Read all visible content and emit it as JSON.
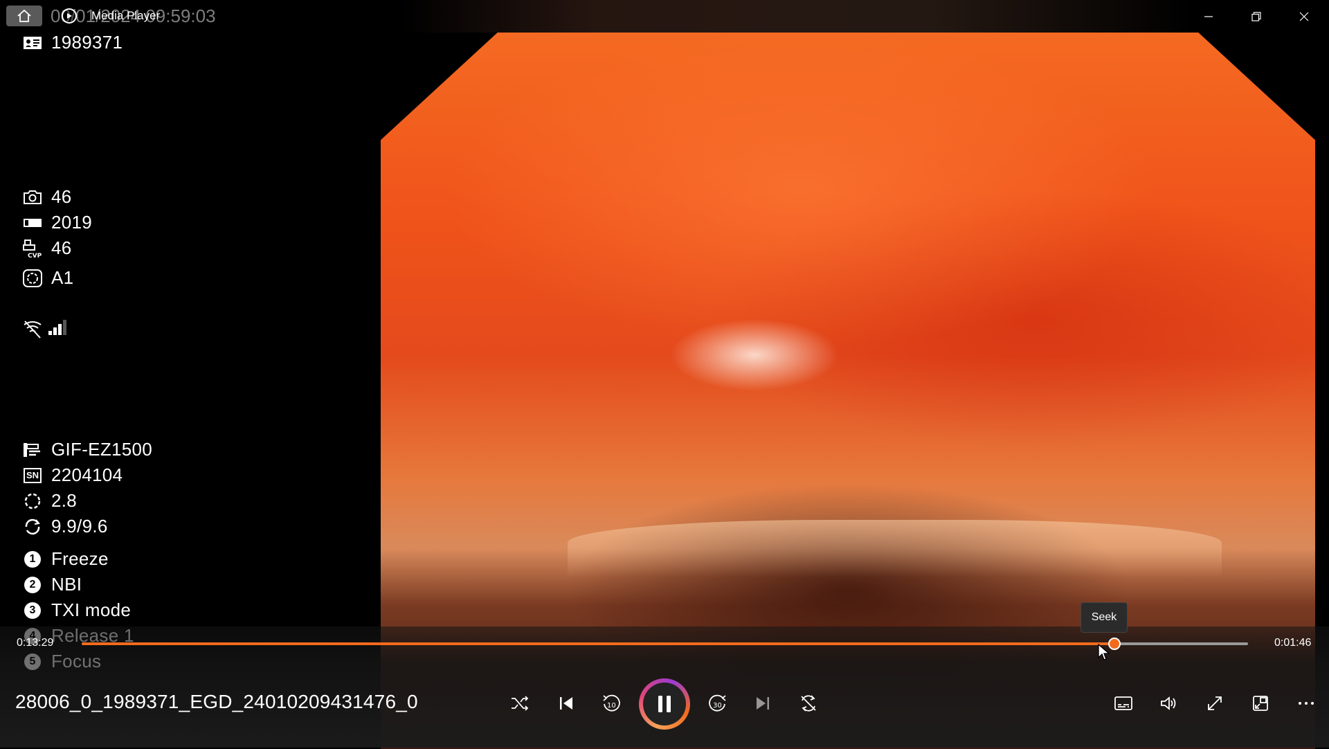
{
  "window": {
    "app_title": "Media Player",
    "overlay_datetime": "00/01/2024 09:59:03"
  },
  "overlay": {
    "patient_id": "1989371",
    "items_top": [
      {
        "icon": "camera-icon",
        "text": "46"
      },
      {
        "icon": "memory-bar-icon",
        "text": "2019"
      },
      {
        "icon": "cvp-printer-icon",
        "text": "46"
      },
      {
        "icon": "structure-enhance-icon",
        "text": "A1"
      }
    ],
    "scope": {
      "model": "GIF-EZ1500",
      "sn_label": "SN",
      "serial": "2204104",
      "value_a": "2.8",
      "value_b": "9.9/9.6"
    },
    "functions": [
      {
        "number": "1",
        "label": "Freeze"
      },
      {
        "number": "2",
        "label": "NBI"
      },
      {
        "number": "3",
        "label": "TXI mode"
      },
      {
        "number": "4",
        "label": "Release 1"
      },
      {
        "number": "5",
        "label": "Focus"
      }
    ]
  },
  "playback": {
    "elapsed": "0:13:29",
    "remaining": "0:01:46",
    "progress_fraction": 0.8856,
    "seek_tooltip": "Seek",
    "file_title": "28006_0_1989371_EGD_24010209431476_0",
    "rewind_seconds": "10",
    "forward_seconds": "30"
  },
  "colors": {
    "accent": "#f26b1d",
    "track": "#9a9a9a"
  }
}
